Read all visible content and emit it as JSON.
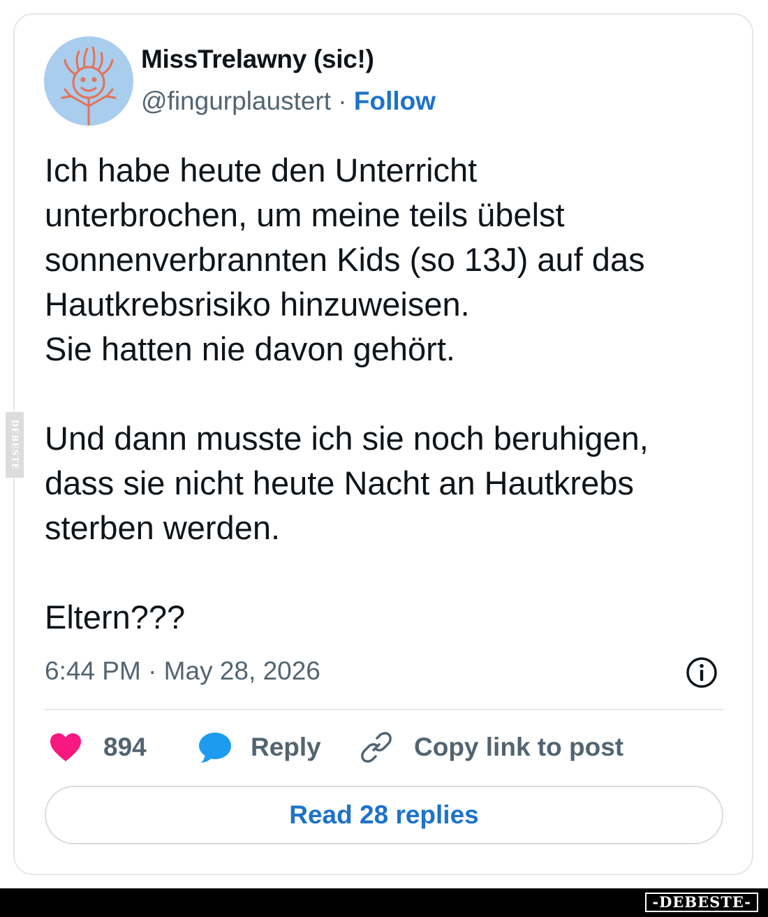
{
  "tweet": {
    "author_name": "MissTrelawny (sic!)",
    "handle": "@fingurplaustert",
    "separator": " · ",
    "follow_label": "Follow",
    "text": "Ich habe heute den Unterricht\nunterbrochen, um meine teils übelst\nsonnenverbrannten Kids (so 13J) auf das\nHautkrebsrisiko hinzuweisen.\nSie hatten nie davon gehört.\n\nUnd dann musste ich sie noch beruhigen,\ndass sie nicht heute Nacht an Hautkrebs\nsterben werden.\n\nEltern???",
    "timestamp": "6:44 PM · May 28, 2026",
    "info_icon": "info-circle-icon"
  },
  "actions": {
    "likes": {
      "icon": "heart-icon",
      "count": "894"
    },
    "reply": {
      "icon": "speech-bubble-icon",
      "label": "Reply"
    },
    "copy_link": {
      "icon": "link-icon",
      "label": "Copy link to post"
    }
  },
  "read_replies_label": "Read 28 replies",
  "watermark": {
    "side_text": "DEBESTE",
    "bottom_logo": "-DEBESTE-"
  },
  "colors": {
    "link_blue": "#1d72c9",
    "heart_pink": "#f91880",
    "bubble_blue": "#1d9bf0",
    "muted_gray": "#536471",
    "avatar_bg": "#a9cdec",
    "avatar_drawing": "#e57058"
  }
}
